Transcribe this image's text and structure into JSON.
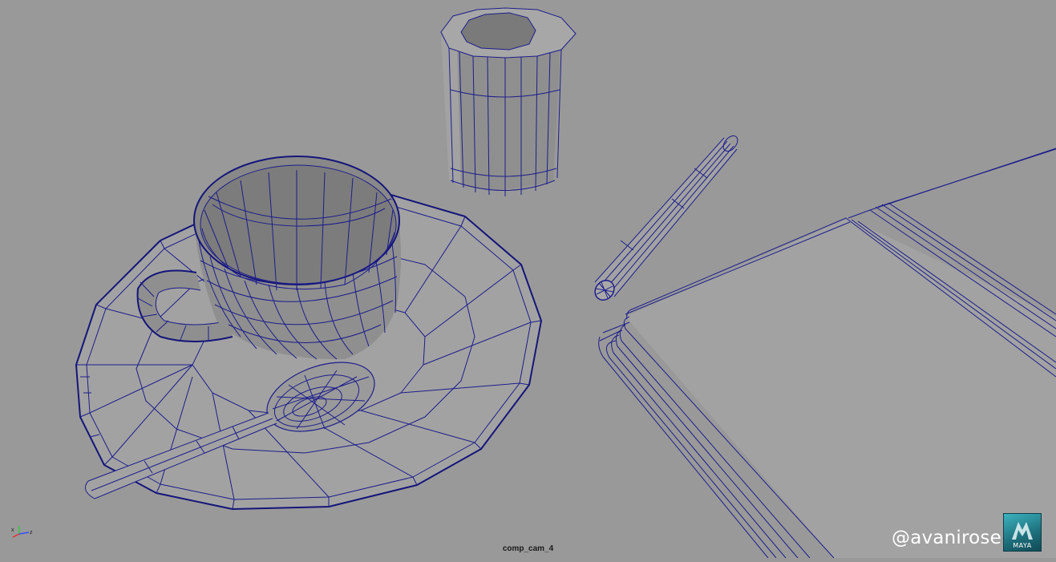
{
  "viewport": {
    "camera_name": "comp_cam_4",
    "background_color": "#999999",
    "wire_color": "#1d1d8c"
  },
  "scene_objects": [
    {
      "name": "cup",
      "icon": "cup-wireframe"
    },
    {
      "name": "saucer",
      "icon": "saucer-wireframe"
    },
    {
      "name": "spoon",
      "icon": "spoon-wireframe"
    },
    {
      "name": "creamer",
      "icon": "creamer-wireframe"
    },
    {
      "name": "pen",
      "icon": "pen-wireframe"
    },
    {
      "name": "book",
      "icon": "book-wireframe"
    }
  ],
  "axis_gizmo": {
    "x_label": "x",
    "z_label": "z",
    "y_color": "#2ecc40",
    "x_color": "#e03030",
    "z_color": "#3050ff"
  },
  "watermark": {
    "text": "@avanirose"
  },
  "logo": {
    "text": "MAYA",
    "color": "#2a8f9c"
  }
}
